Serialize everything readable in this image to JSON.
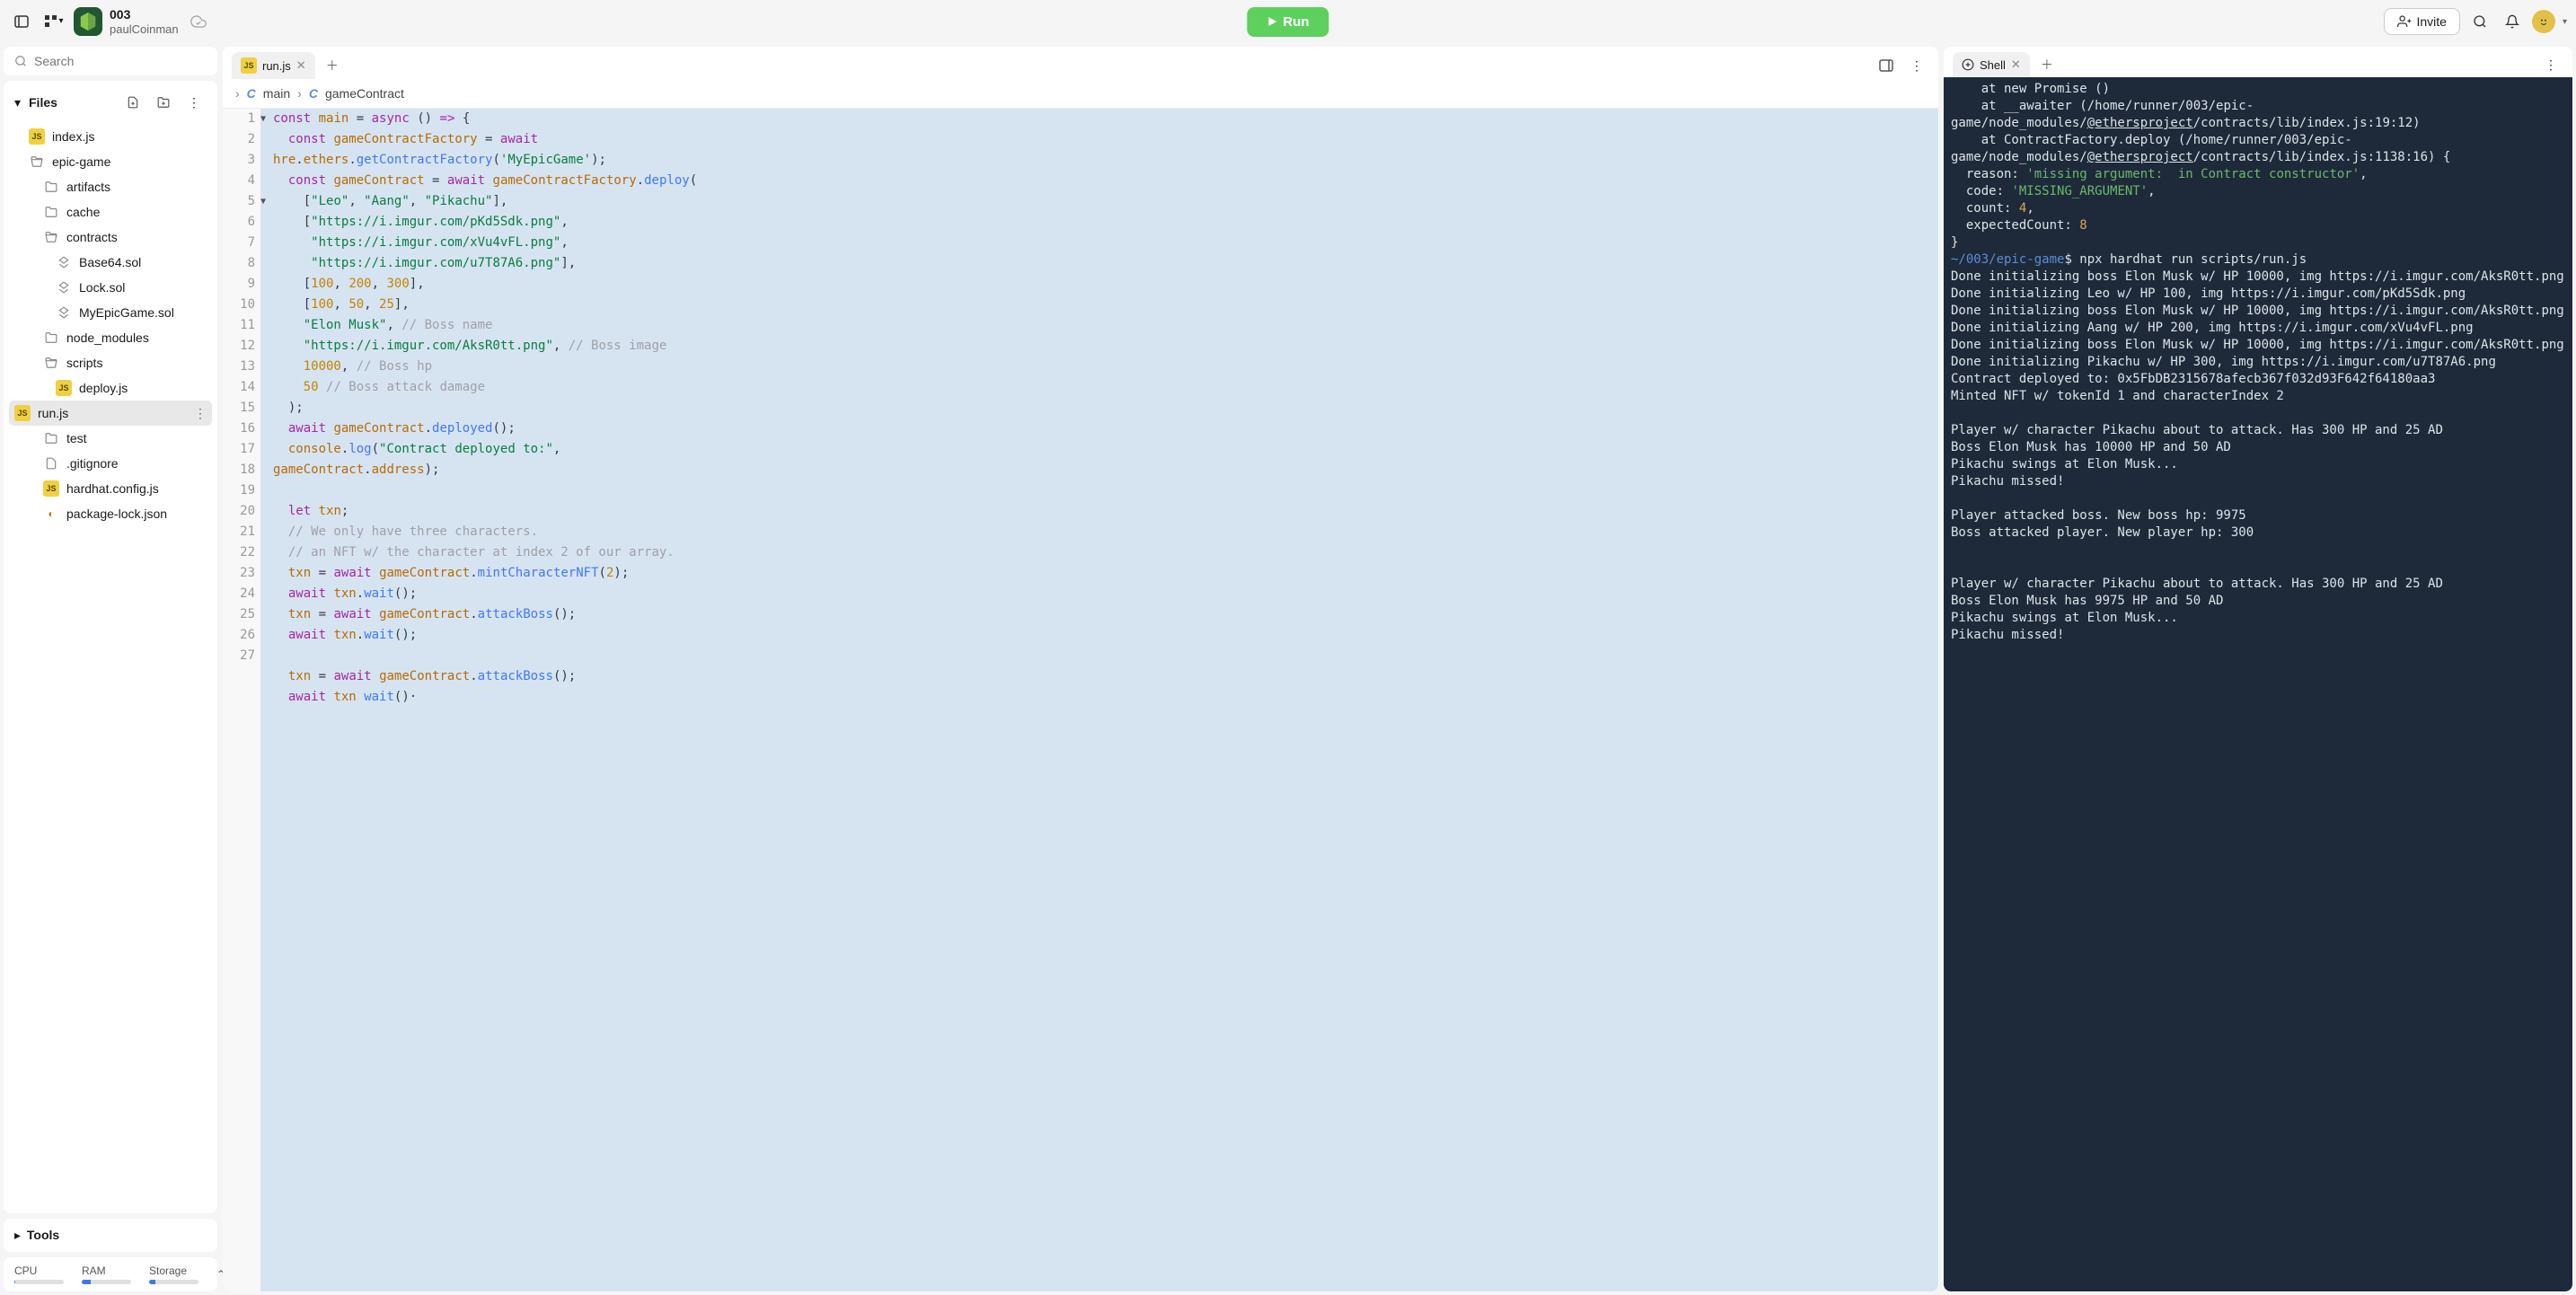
{
  "project": {
    "title": "003",
    "user": "paulCoinman"
  },
  "run_label": "Run",
  "invite_label": "Invite",
  "search": {
    "placeholder": "Search"
  },
  "files": {
    "header": "Files",
    "items": [
      {
        "name": "index.js",
        "type": "js",
        "indent": 1
      },
      {
        "name": "epic-game",
        "type": "folder-open",
        "indent": 1
      },
      {
        "name": "artifacts",
        "type": "folder",
        "indent": 2
      },
      {
        "name": "cache",
        "type": "folder",
        "indent": 2
      },
      {
        "name": "contracts",
        "type": "folder-open",
        "indent": 2
      },
      {
        "name": "Base64.sol",
        "type": "sol",
        "indent": 3
      },
      {
        "name": "Lock.sol",
        "type": "sol",
        "indent": 3
      },
      {
        "name": "MyEpicGame.sol",
        "type": "sol",
        "indent": 3
      },
      {
        "name": "node_modules",
        "type": "folder",
        "indent": 2
      },
      {
        "name": "scripts",
        "type": "folder-open",
        "indent": 2
      },
      {
        "name": "deploy.js",
        "type": "js",
        "indent": 3
      },
      {
        "name": "run.js",
        "type": "js",
        "indent": 3,
        "active": true
      },
      {
        "name": "test",
        "type": "folder",
        "indent": 2
      },
      {
        "name": ".gitignore",
        "type": "file",
        "indent": 2
      },
      {
        "name": "hardhat.config.js",
        "type": "js",
        "indent": 2
      },
      {
        "name": "package-lock.json",
        "type": "json",
        "indent": 2
      }
    ]
  },
  "tools_label": "Tools",
  "stats": {
    "cpu": "CPU",
    "ram": "RAM",
    "storage": "Storage",
    "cpu_pct": 2,
    "ram_pct": 18,
    "storage_pct": 12
  },
  "editor": {
    "tab_file": "run.js",
    "breadcrumb": [
      "main",
      "gameContract"
    ]
  },
  "shell": {
    "tab": "Shell"
  },
  "shell_text_prefix": "    at new Promise (<anonymous>)\n    at __awaiter (/home/runner/003/epic-game/node_modules/",
  "shell_link1": "@ethersproject",
  "shell_text_mid1": "/contracts/lib/index.js:19:12)\n    at ContractFactory.deploy (/home/runner/003/epic-game/node_modules/",
  "shell_link2": "@ethersproject",
  "shell_text_mid2": "/contracts/lib/index.js:1138:16) {\n  reason: ",
  "shell_str1": "'missing argument:  in Contract constructor'",
  "shell_text_mid3": ",\n  code: ",
  "shell_str2": "'MISSING_ARGUMENT'",
  "shell_text_mid4": ",\n  count: ",
  "shell_num1": "4",
  "shell_text_mid5": ",\n  expectedCount: ",
  "shell_num2": "8",
  "shell_text_mid6": "\n}\n",
  "shell_path": "~/003/epic-game",
  "shell_cmd": "$ npx hardhat run scripts/run.js\n",
  "shell_output": "Done initializing boss Elon Musk w/ HP 10000, img https://i.imgur.com/AksR0tt.png\nDone initializing Leo w/ HP 100, img https://i.imgur.com/pKd5Sdk.png\nDone initializing boss Elon Musk w/ HP 10000, img https://i.imgur.com/AksR0tt.png\nDone initializing Aang w/ HP 200, img https://i.imgur.com/xVu4vFL.png\nDone initializing boss Elon Musk w/ HP 10000, img https://i.imgur.com/AksR0tt.png\nDone initializing Pikachu w/ HP 300, img https://i.imgur.com/u7T87A6.png\nContract deployed to: 0x5FbDB2315678afecb367f032d93F642f64180aa3\nMinted NFT w/ tokenId 1 and characterIndex 2\n\nPlayer w/ character Pikachu about to attack. Has 300 HP and 25 AD\nBoss Elon Musk has 10000 HP and 50 AD\nPikachu swings at Elon Musk...\nPikachu missed!\n\nPlayer attacked boss. New boss hp: 9975\nBoss attacked player. New player hp: 300\n\n\nPlayer w/ character Pikachu about to attack. Has 300 HP and 25 AD\nBoss Elon Musk has 9975 HP and 50 AD\nPikachu swings at Elon Musk...\nPikachu missed!"
}
